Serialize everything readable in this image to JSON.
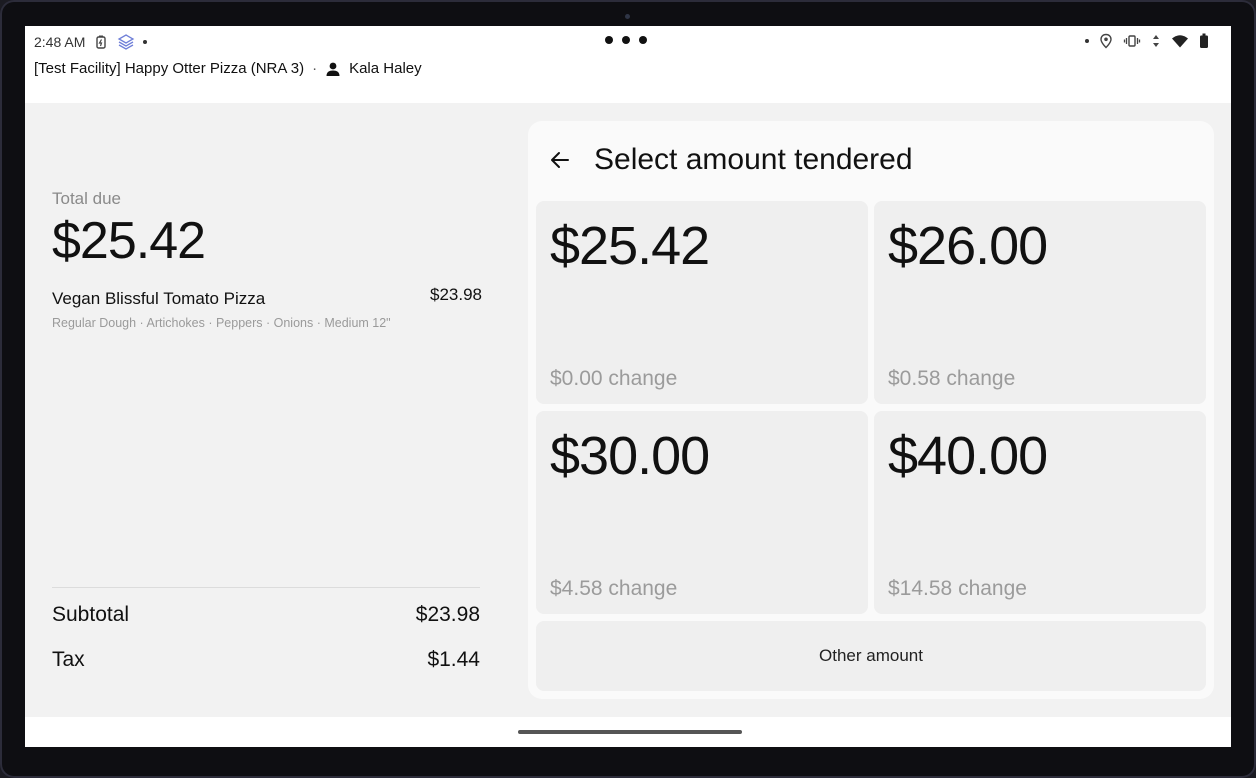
{
  "status_bar": {
    "time": "2:48 AM",
    "left_icons": [
      "battery-saver-icon",
      "app-stack-icon"
    ],
    "right_icons": [
      "location-icon",
      "vibrate-icon",
      "data-arrows-icon",
      "wifi-icon",
      "battery-icon"
    ]
  },
  "header": {
    "facility": "[Test Facility] Happy Otter Pizza (NRA 3)",
    "separator": "·",
    "user_name": "Kala Haley"
  },
  "order": {
    "total_label": "Total due",
    "total_amount": "$25.42",
    "items": [
      {
        "name": "Vegan Blissful Tomato Pizza",
        "price": "$23.98",
        "modifiers": "Regular Dough · Artichokes · Peppers · Onions · Medium 12\""
      }
    ],
    "subtotal_label": "Subtotal",
    "subtotal_value": "$23.98",
    "tax_label": "Tax",
    "tax_value": "$1.44"
  },
  "tender": {
    "title": "Select amount tendered",
    "options": [
      {
        "amount": "$25.42",
        "change": "$0.00 change"
      },
      {
        "amount": "$26.00",
        "change": "$0.58 change"
      },
      {
        "amount": "$30.00",
        "change": "$4.58 change"
      },
      {
        "amount": "$40.00",
        "change": "$14.58 change"
      }
    ],
    "other_label": "Other amount"
  },
  "colors": {
    "background": "#f2f2f2",
    "card": "#fafafa",
    "tile": "#efefef",
    "text": "#111111",
    "muted": "#9b9b9b"
  }
}
